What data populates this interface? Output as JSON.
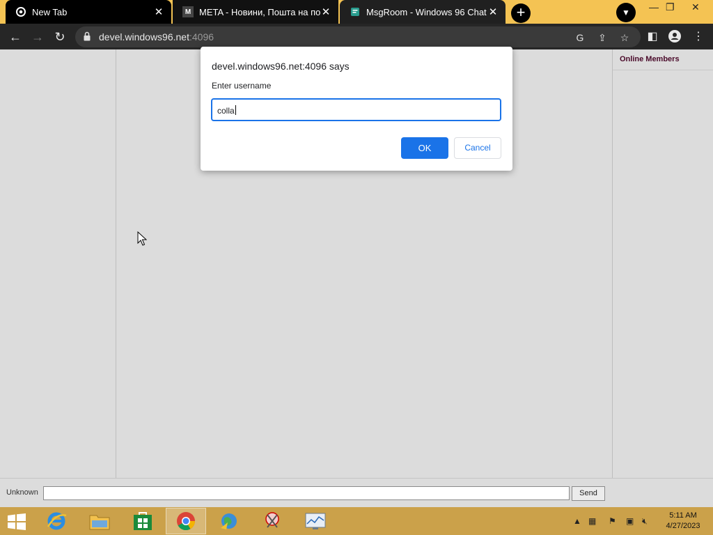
{
  "browser": {
    "tabs": [
      {
        "title": "New Tab",
        "icon": "chrome-icon"
      },
      {
        "title": "META - Новини, Пошта на порт",
        "icon": "meta-favicon"
      },
      {
        "title": "MsgRoom - Windows 96 Chat",
        "icon": "msgroom-favicon"
      }
    ],
    "url_host": "devel.windows96.net",
    "url_port": ":4096"
  },
  "chat": {
    "members_heading": "Online Members",
    "username_label": "Unknown",
    "message_value": "",
    "send_label": "Send"
  },
  "dialog": {
    "title": "devel.windows96.net:4096 says",
    "message": "Enter username",
    "input_value": "colla",
    "ok_label": "OK",
    "cancel_label": "Cancel"
  },
  "taskbar": {
    "time": "5:11 AM",
    "date": "4/27/2023"
  },
  "colors": {
    "accent": "#1a73e8",
    "tabstrip": "#f4c353",
    "taskbar": "#cba14a"
  }
}
